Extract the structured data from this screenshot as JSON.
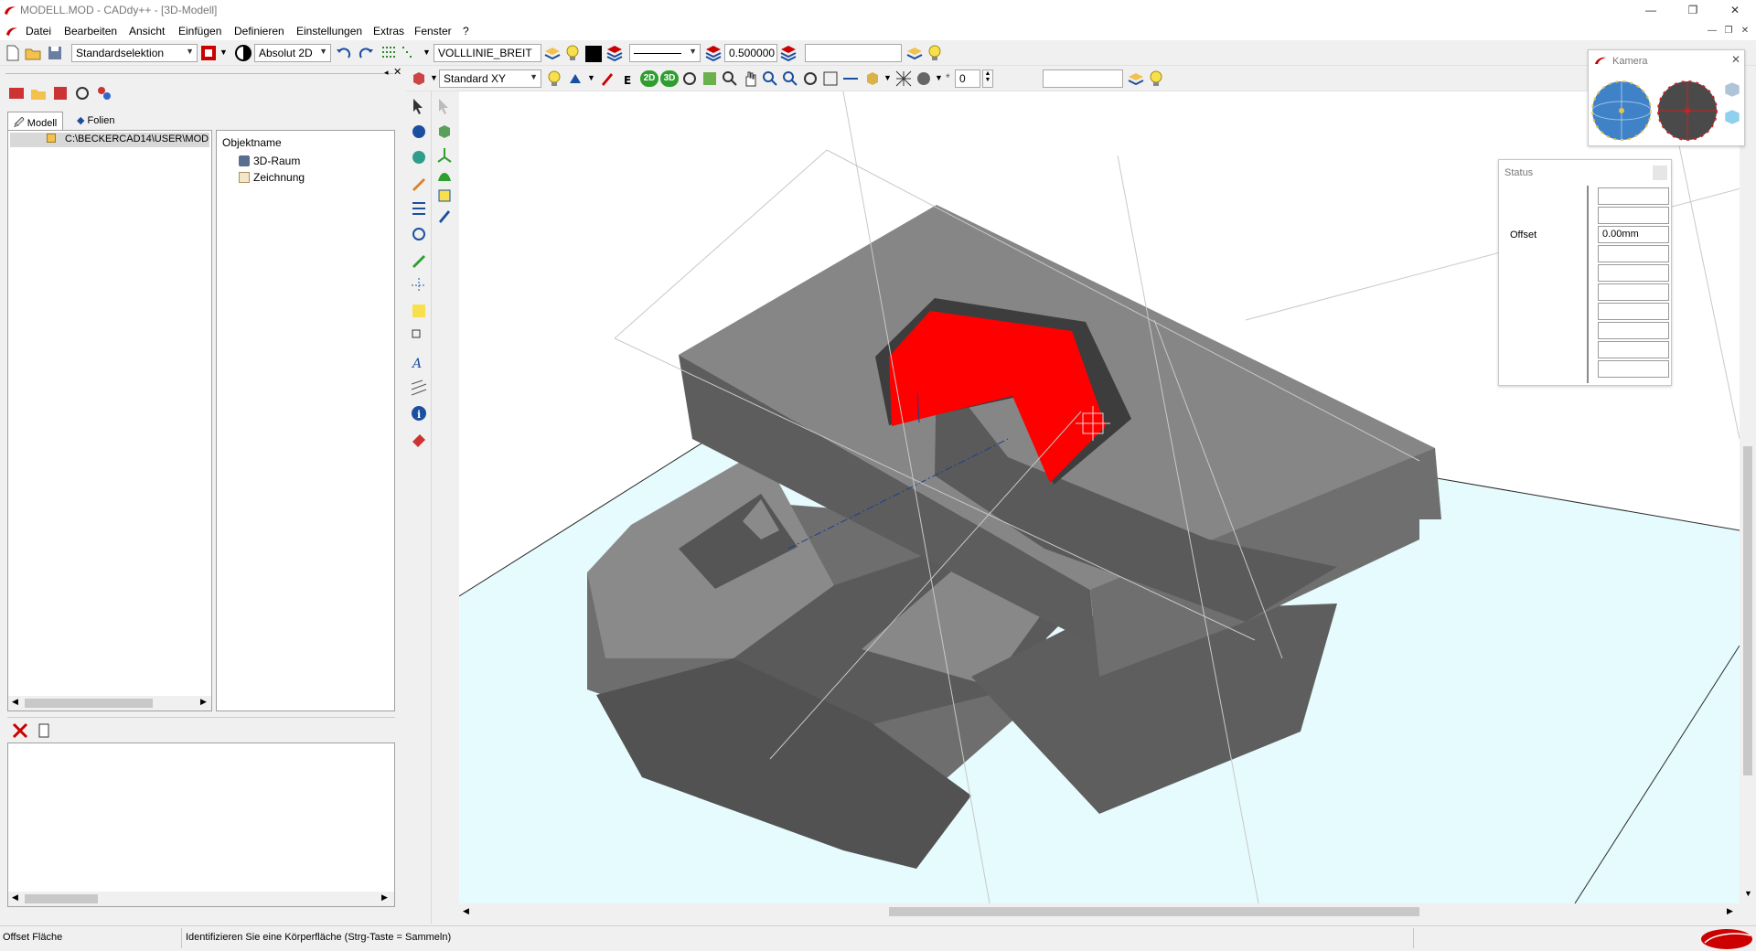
{
  "window": {
    "title": "MODELL.MOD  -  CADdy++ - [3D-Modell]",
    "minimize": "—",
    "restore": "❐",
    "close": "✕"
  },
  "menu": {
    "items": [
      "Datei",
      "Bearbeiten",
      "Ansicht",
      "Einfügen",
      "Definieren",
      "Einstellungen",
      "Extras",
      "Fenster",
      "?"
    ]
  },
  "toolbar1": {
    "selection_mode": "Standardselektion",
    "coord_mode": "Absolut 2D",
    "line_type": "VOLLLINIE_BREIT",
    "line_width": "0.500000",
    "empty_field": ""
  },
  "toolbar2": {
    "view_mode": "Standard XY",
    "btn_2d": "2D",
    "btn_3d": "3D",
    "layer_value": "0",
    "empty_field": ""
  },
  "left_panel": {
    "tabs": [
      {
        "label": "Modell"
      },
      {
        "label": "Folien"
      }
    ],
    "path": "C:\\BECKERCAD14\\USER\\MOD",
    "object_header": "Objektname",
    "objects": [
      {
        "label": "3D-Raum"
      },
      {
        "label": "Zeichnung"
      }
    ]
  },
  "camera_panel": {
    "title": "Kamera"
  },
  "status_panel": {
    "title": "Status",
    "offset_label": "Offset",
    "offset_value": "0.00mm"
  },
  "statusbar": {
    "mode": "Offset Fläche",
    "message": "Identifizieren Sie eine Körperfläche (Strg-Taste = Sammeln)"
  },
  "colors": {
    "selected_face": "#ff0000",
    "solid_light": "#888888",
    "solid_dark": "#555555",
    "ground_plane": "#e6fbfd",
    "brand_red": "#cc0000"
  },
  "icons": {
    "file_tools": [
      "new-file-icon",
      "open-file-icon",
      "save-icon"
    ],
    "camera_views": [
      "globe-view-icon",
      "sphere-red-icon",
      "cube-view-icon"
    ]
  }
}
